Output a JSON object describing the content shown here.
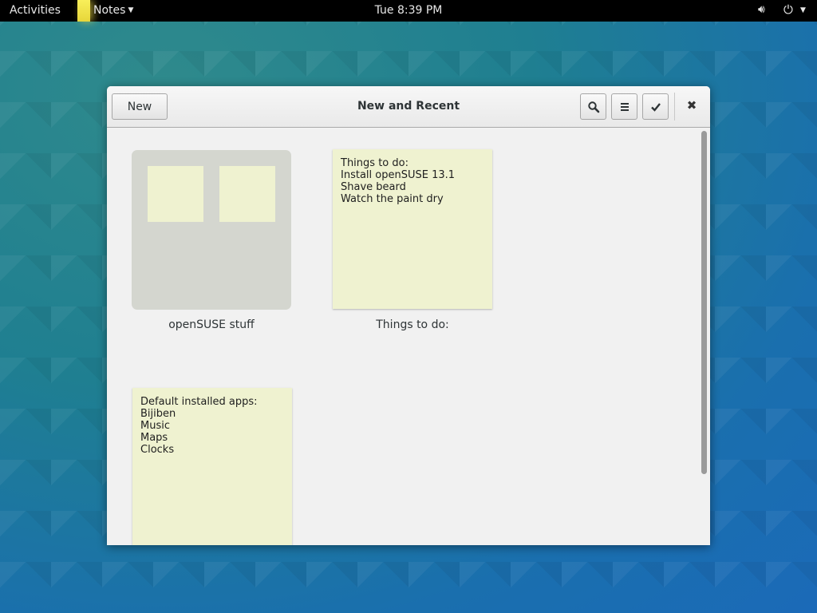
{
  "topbar": {
    "activities": "Activities",
    "app_name": "Notes",
    "clock": "Tue  8:39 PM",
    "app_icon": "notes-app-icon",
    "volume_icon": "speaker-icon",
    "power_icon": "power-icon"
  },
  "window": {
    "new_label": "New",
    "title": "New and Recent",
    "search_icon": "search-icon",
    "menu_icon": "menu-icon",
    "select_icon": "checkmark-icon",
    "close_icon": "close-icon"
  },
  "items": {
    "folder": {
      "label": "openSUSE stuff"
    },
    "note1": {
      "lines": [
        "Things to do:",
        "Install openSUSE 13.1",
        "Shave beard",
        "Watch the paint dry"
      ],
      "label": "Things to do:"
    },
    "note2": {
      "lines": [
        "Default installed apps:",
        "Bijiben",
        "Music",
        "Maps",
        "Clocks"
      ]
    }
  },
  "colors": {
    "note_bg": "#eff2d0",
    "folder_bg": "#d4d6cf",
    "topbar_bg": "#000000"
  }
}
